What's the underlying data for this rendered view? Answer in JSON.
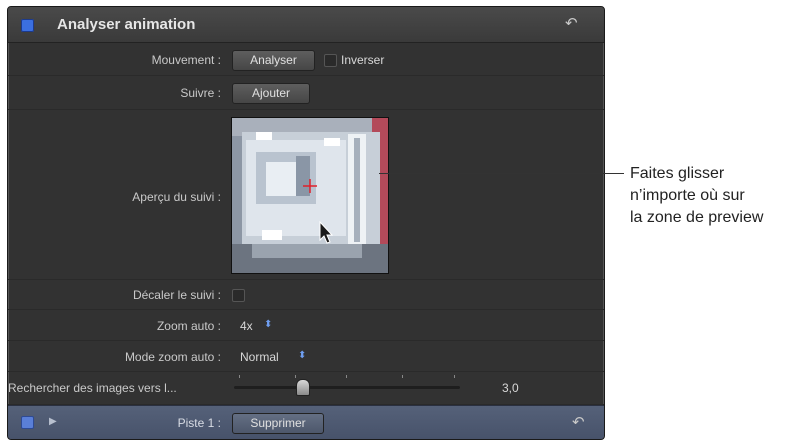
{
  "header": {
    "title": "Analyser animation",
    "reset_icon": "reset-arrow-icon"
  },
  "rows": {
    "movement": {
      "label": "Mouvement :",
      "button": "Analyser",
      "checkbox_label": "Inverser"
    },
    "follow": {
      "label": "Suivre :",
      "button": "Ajouter"
    },
    "preview": {
      "label": "Aperçu du suivi :"
    },
    "offset": {
      "label": "Décaler le suivi :"
    },
    "zoom": {
      "label": "Zoom auto :",
      "value": "4x"
    },
    "zoom_mode": {
      "label": "Mode zoom auto :",
      "value": "Normal"
    },
    "search": {
      "label": "Rechercher des images vers l...",
      "value": "3,0"
    }
  },
  "footer": {
    "label": "Piste 1 :",
    "button": "Supprimer"
  },
  "callout": {
    "line1": "Faites glisser",
    "line2": "n’importe où sur",
    "line3": "la zone de preview"
  },
  "colors": {
    "panel": "#323232",
    "accent": "#3b6fe0",
    "footer": "#4e5a72"
  }
}
